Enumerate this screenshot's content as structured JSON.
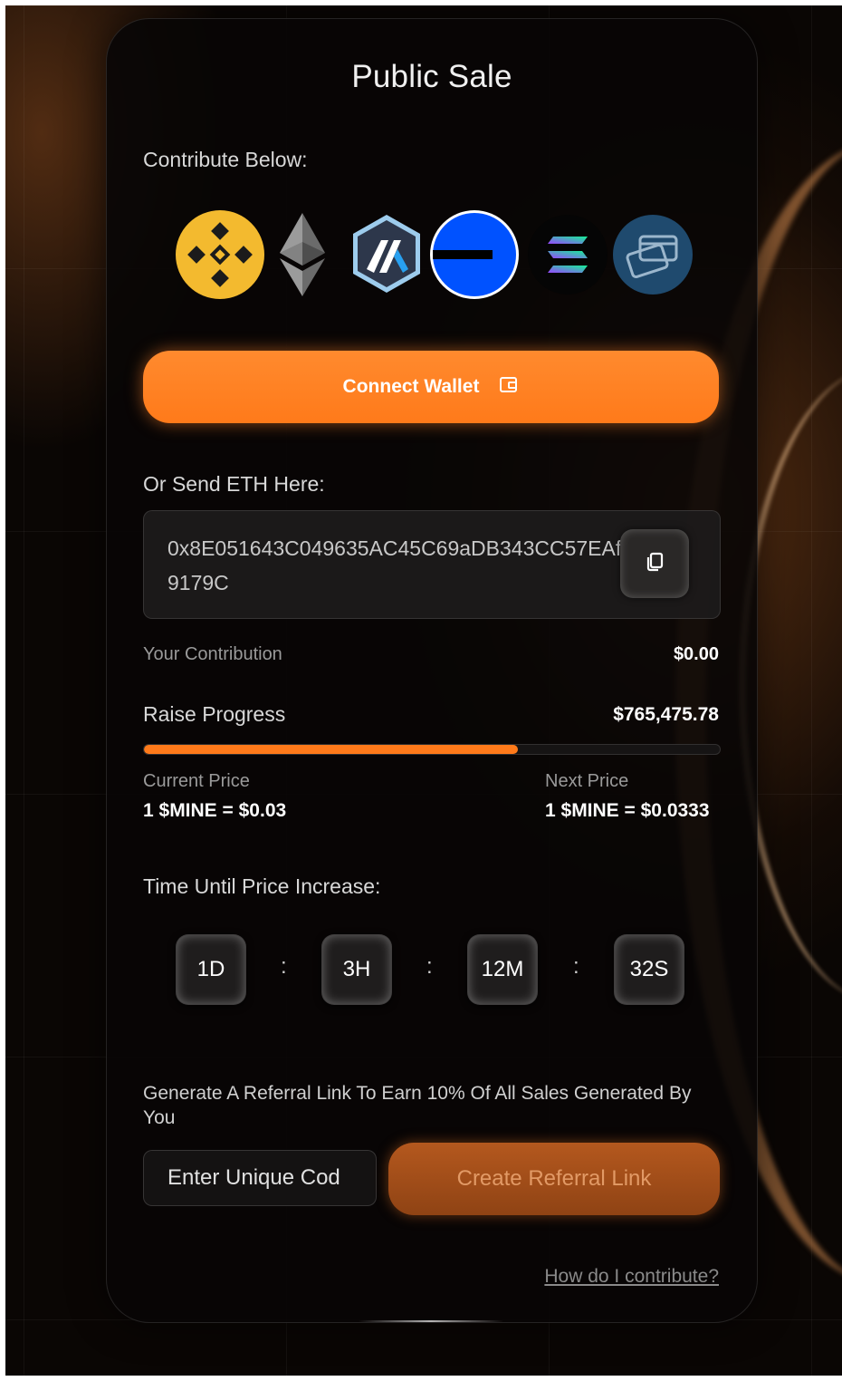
{
  "sale": {
    "title": "Public Sale",
    "contribute_label": "Contribute Below:",
    "payment_methods": [
      {
        "name": "bnb-icon",
        "color": "#f3ba2f"
      },
      {
        "name": "ethereum-icon",
        "color": "#8c8c8c"
      },
      {
        "name": "arbitrum-icon",
        "color": "#2d374b"
      },
      {
        "name": "base-icon",
        "color": "#0052ff"
      },
      {
        "name": "solana-icon",
        "color": "#14f195"
      },
      {
        "name": "card-icon",
        "color": "#1f4a6e"
      }
    ],
    "connect_wallet_label": "Connect Wallet",
    "send_eth_label": "Or Send ETH Here:",
    "eth_address": "0x8E051643C049635AC45C69aDB343CC57EAf9179C",
    "your_contribution_label": "Your Contribution",
    "your_contribution_value": "$0.00",
    "raise_progress_label": "Raise Progress",
    "raise_progress_value": "$765,475.78",
    "raise_progress_fraction": 0.65,
    "current_price_label": "Current Price",
    "current_price_value": "1 $MINE = $0.03",
    "next_price_label": "Next Price",
    "next_price_value": "1 $MINE = $0.0333",
    "timer_label": "Time Until Price Increase:",
    "timer": {
      "days": "1D",
      "hours": "3H",
      "minutes": "12M",
      "seconds": "32S",
      "separator": ":"
    },
    "referral_text": "Generate A Referral Link To Earn 10% Of All Sales Generated By You",
    "referral_input_placeholder": "Enter Unique Cod",
    "create_referral_label": "Create Referral Link",
    "help_link": "How do I contribute?"
  },
  "colors": {
    "accent": "#ff7a1a",
    "referral_button": "#a24d18"
  }
}
